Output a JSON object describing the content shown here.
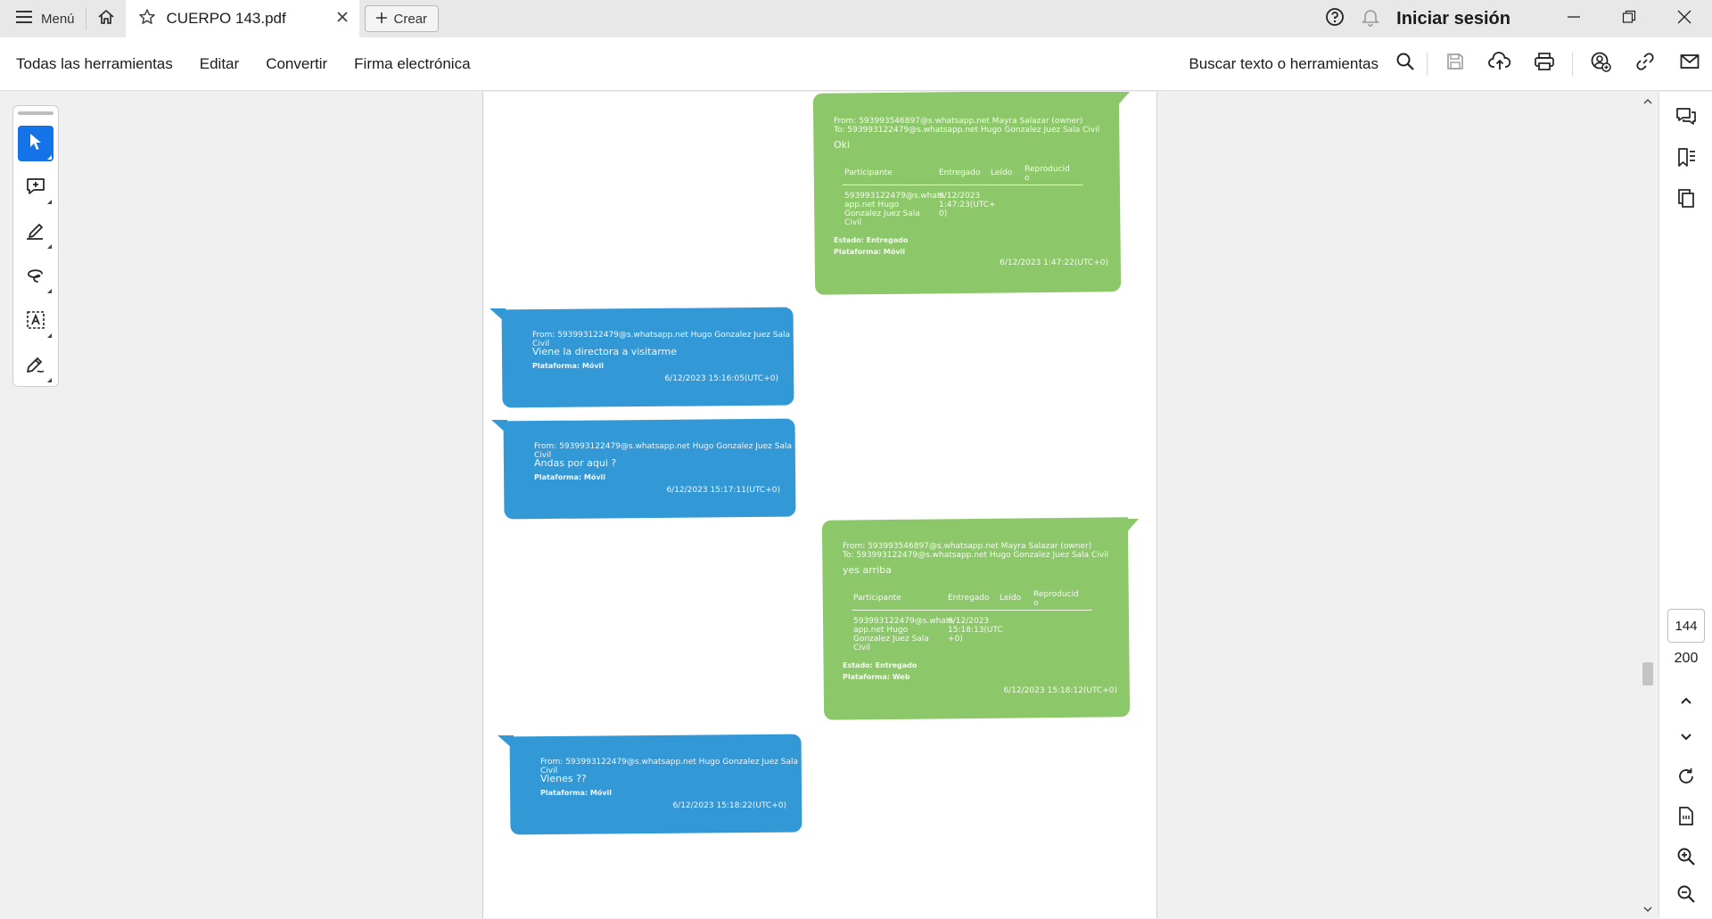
{
  "app": {
    "menu_label": "Menú",
    "tab_title": "CUERPO 143.pdf",
    "new_label": "Crear",
    "signin_label": "Iniciar sesión"
  },
  "toolbar": {
    "menus": [
      "Todas las herramientas",
      "Editar",
      "Convertir",
      "Firma electrónica"
    ],
    "search_label": "Buscar texto o herramientas"
  },
  "left_tools": [
    "select-tool",
    "add-comment-tool",
    "highlight-tool",
    "draw-tool",
    "text-recognition-tool",
    "sign-tool"
  ],
  "right_rail": {
    "current_page": "144",
    "total_pages": "200"
  },
  "messages": [
    {
      "kind": "received",
      "from": "From: 593993546897@s.whatsapp.net Mayra Salazar (owner)",
      "to": "To: 593993122479@s.whatsapp.net Hugo Gonzalez Juez Sala Civil",
      "text": "Oki",
      "receipt_headers": [
        "Participante",
        "Entregado",
        "Leído",
        "Reproducid o"
      ],
      "receipt_row": [
        "593993122479@s.whats app.net Hugo Gonzalez Juez Sala Civil",
        "6/12/2023 1:47:23(UTC+ 0)",
        "",
        ""
      ],
      "status": "Estado: Entregado",
      "platform": "Plataforma: Móvil",
      "timestamp": "6/12/2023 1:47:22(UTC+0)"
    },
    {
      "kind": "sent",
      "from": "From: 593993122479@s.whatsapp.net Hugo Gonzalez Juez Sala Civil",
      "text": "Viene la directora a visitarme",
      "platform": "Plataforma: Móvil",
      "timestamp": "6/12/2023 15:16:05(UTC+0)"
    },
    {
      "kind": "sent",
      "from": "From: 593993122479@s.whatsapp.net Hugo Gonzalez Juez Sala Civil",
      "text": "Andas por aqui ?",
      "platform": "Plataforma: Móvil",
      "timestamp": "6/12/2023 15:17:11(UTC+0)"
    },
    {
      "kind": "received",
      "from": "From: 593993546897@s.whatsapp.net Mayra Salazar (owner)",
      "to": "To: 593993122479@s.whatsapp.net Hugo Gonzalez Juez Sala Civil",
      "text": "yes arriba",
      "receipt_headers": [
        "Participante",
        "Entregado",
        "Leído",
        "Reproducid o"
      ],
      "receipt_row": [
        "593993122479@s.whats app.net Hugo Gonzalez Juez Sala Civil",
        "6/12/2023 15:18:13(UTC +0)",
        "",
        ""
      ],
      "status": "Estado: Entregado",
      "platform": "Plataforma: Web",
      "timestamp": "6/12/2023 15:18:12(UTC+0)"
    },
    {
      "kind": "sent",
      "from": "From: 593993122479@s.whatsapp.net Hugo Gonzalez Juez Sala Civil",
      "text": "Vienes ??",
      "platform": "Plataforma: Móvil",
      "timestamp": "6/12/2023 15:18:22(UTC+0)"
    }
  ]
}
